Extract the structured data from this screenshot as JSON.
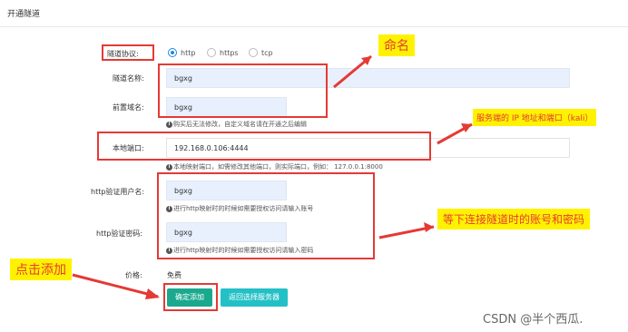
{
  "header": {
    "title": "开通隧道"
  },
  "form": {
    "protocol": {
      "label": "隧道协议:",
      "options": [
        "http",
        "https",
        "tcp"
      ],
      "selected": "http"
    },
    "tunnel_name": {
      "label": "隧道名称:",
      "value": "bgxg"
    },
    "domain_prefix": {
      "label": "前置域名:",
      "value": "bgxg",
      "hint": "购买后无法修改，自定义域名请在开通之后编辑"
    },
    "local_port": {
      "label": "本地端口:",
      "value": "192.168.0.106:4444",
      "hint": "本地映射端口，如需修改其他端口，则实际端口，例如： 127.0.0.1:8000"
    },
    "http_user": {
      "label": "http验证用户名:",
      "value": "bgxg",
      "hint": "进行http映射时的时候如需要授权访问请输入账号"
    },
    "http_pass": {
      "label": "http验证密码:",
      "value": "bgxg",
      "hint": "进行http映射时的时候如需要授权访问请输入密码"
    },
    "price": {
      "label": "价格:",
      "value": "免费"
    }
  },
  "buttons": {
    "confirm": "确定添加",
    "back": "返回选择服务器"
  },
  "annotations": {
    "naming": "命名",
    "server_ip": "服务端的 IP 地址和端口（kali）",
    "credentials": "等下连接隧道时的账号和密码",
    "click_add": "点击添加"
  },
  "watermark": "CSDN @半个西瓜.",
  "colors": {
    "accent": "#1e88e5",
    "primary_button": "#1aa98e",
    "secondary_button": "#23c0c6",
    "annotation_red": "#e53935",
    "annotation_yellow": "#fff200"
  }
}
